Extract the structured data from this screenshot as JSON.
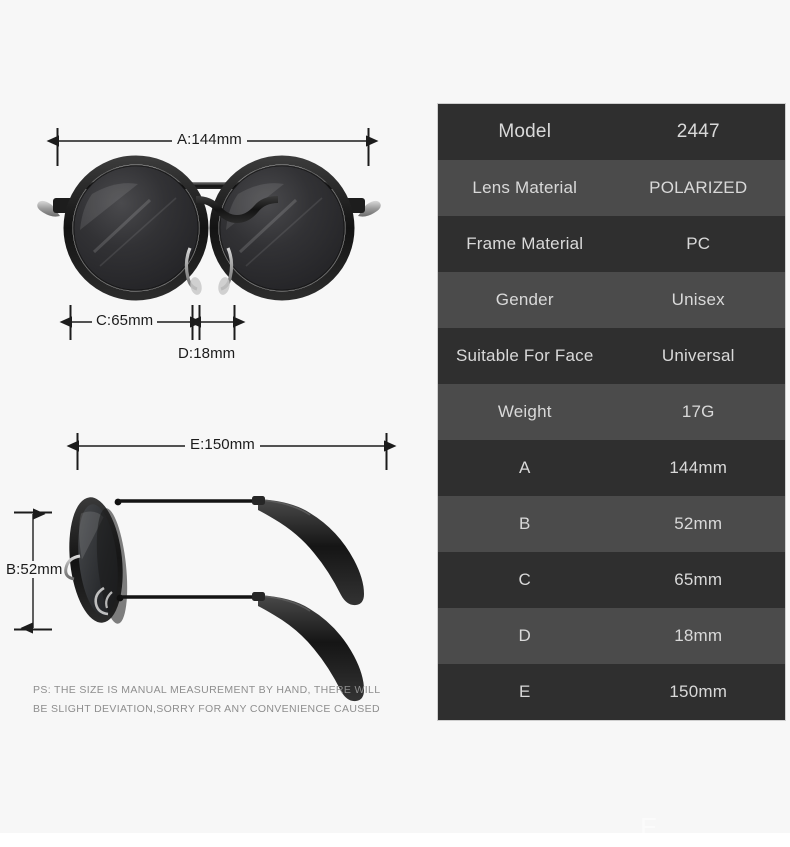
{
  "product": {
    "type": "sunglasses-spec-sheet",
    "background_color": "#f7f7f7"
  },
  "dimensions": {
    "a": "A:144mm",
    "b": "B:52mm",
    "c": "C:65mm",
    "d": "D:18mm",
    "e": "E:150mm"
  },
  "disclaimer": {
    "line1": "PS: THE SIZE IS MANUAL MEASUREMENT BY HAND, THERE WILL",
    "line2": "BE SLIGHT DEVIATION,SORRY FOR ANY CONVENIENCE CAUSED"
  },
  "watermark": {
    "text": "E"
  },
  "spec_table": {
    "row_color_odd": "#2f2f2f",
    "row_color_even": "#4b4b4b",
    "text_color": "#d9d9d9",
    "rows": [
      {
        "key": "Model",
        "value": "2447"
      },
      {
        "key": "Lens Material",
        "value": "POLARIZED"
      },
      {
        "key": "Frame Material",
        "value": "PC"
      },
      {
        "key": "Gender",
        "value": "Unisex"
      },
      {
        "key": "Suitable For Face",
        "value": "Universal"
      },
      {
        "key": "Weight",
        "value": "17G"
      },
      {
        "key": "A",
        "value": "144mm"
      },
      {
        "key": "B",
        "value": "52mm"
      },
      {
        "key": "C",
        "value": "65mm"
      },
      {
        "key": "D",
        "value": "18mm"
      },
      {
        "key": "E",
        "value": "150mm"
      }
    ]
  }
}
